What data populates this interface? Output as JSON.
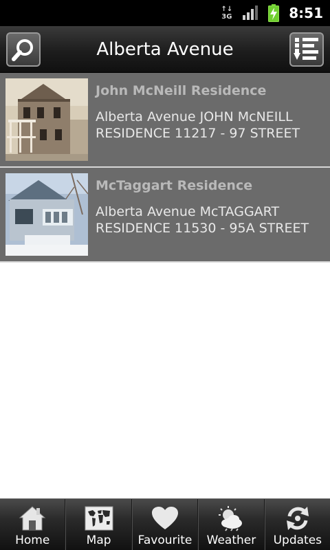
{
  "status_bar": {
    "network_top": "↑↓",
    "network_type": "3G",
    "time": "8:51"
  },
  "header": {
    "title": "Alberta Avenue",
    "search_icon": "search-icon",
    "sort_icon": "sort-list-icon"
  },
  "list": {
    "items": [
      {
        "title": "John McNeill Residence",
        "description": "Alberta Avenue JOHN McNEILL RESIDENCE 11217 - 97 STREET",
        "image": "sepia-two-storey-brick-house-photo"
      },
      {
        "title": "McTaggart Residence",
        "description": "Alberta Avenue McTAGGART RESIDENCE 11530 - 95A STREET",
        "image": "blue-bungalow-with-porch-photo"
      }
    ]
  },
  "tabs": [
    {
      "label": "Home",
      "icon": "home-icon"
    },
    {
      "label": "Map",
      "icon": "map-icon"
    },
    {
      "label": "Favourite",
      "icon": "heart-icon"
    },
    {
      "label": "Weather",
      "icon": "weather-icon"
    },
    {
      "label": "Updates",
      "icon": "refresh-icon"
    }
  ],
  "colors": {
    "list_background": "#6b6b6b",
    "title_text": "#b9b9b9",
    "battery_green": "#6fcf2f"
  }
}
